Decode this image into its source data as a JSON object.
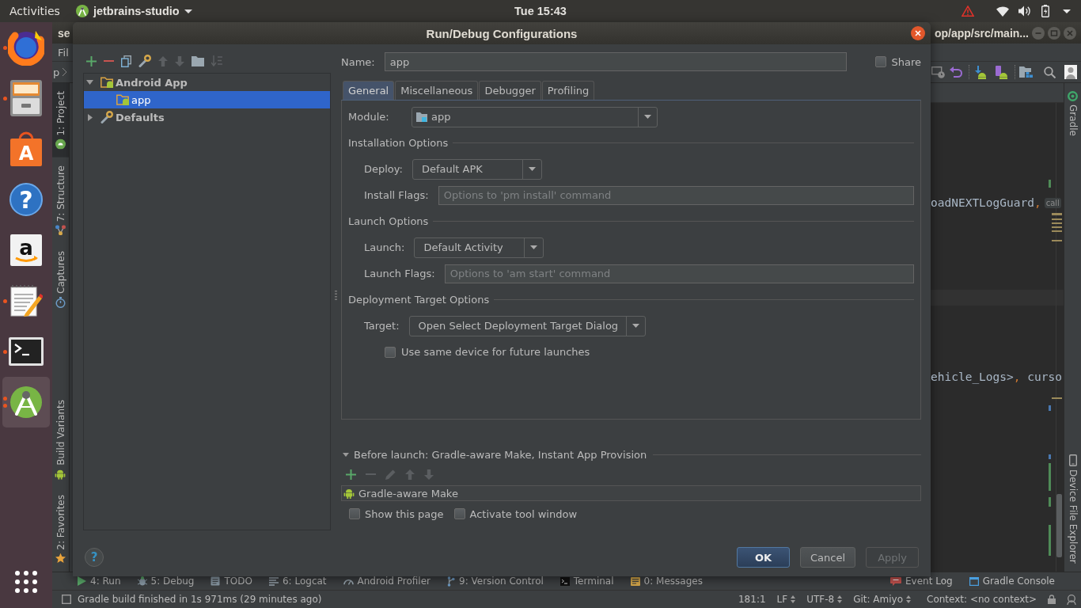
{
  "top_bar": {
    "activities": "Activities",
    "app_menu": "jetbrains-studio",
    "clock": "Tue 15:43"
  },
  "dock": {
    "items": [
      {
        "kind": "firefox",
        "running": true,
        "multi_window": false,
        "selected": false
      },
      {
        "kind": "files",
        "running": true,
        "multi_window": false,
        "selected": false
      },
      {
        "kind": "software",
        "glyph": "A",
        "running": false,
        "multi_window": false,
        "selected": false
      },
      {
        "kind": "help",
        "glyph": "?",
        "running": false,
        "multi_window": false,
        "selected": false
      },
      {
        "kind": "amazon",
        "glyph": "a",
        "running": false,
        "multi_window": false,
        "selected": false
      },
      {
        "kind": "text-editor",
        "running": true,
        "multi_window": false,
        "selected": false
      },
      {
        "kind": "terminal",
        "running": true,
        "multi_window": false,
        "selected": false
      },
      {
        "kind": "android-studio",
        "running": true,
        "multi_window": true,
        "selected": true
      }
    ]
  },
  "ide": {
    "title_left": "se",
    "title_right": "op/app/src/main...",
    "menu_first": "Fil",
    "breadcrumb": "p",
    "left_tools_top": [
      {
        "label": "1: Project",
        "kind": "android",
        "selected": true
      },
      {
        "label": "7: Structure",
        "kind": "structure",
        "selected": false
      },
      {
        "label": "Captures",
        "kind": "captures",
        "selected": false
      }
    ],
    "left_tools_bottom": [
      {
        "label": "Build Variants",
        "kind": "android-robot",
        "selected": false
      },
      {
        "label": "2: Favorites",
        "kind": "star",
        "selected": false
      }
    ],
    "right_tools_top": [
      {
        "label": "Gradle",
        "kind": "gradle"
      }
    ],
    "right_tools_bottom": [
      {
        "label": "Device File Explorer",
        "kind": "phone"
      }
    ],
    "editor_lines": [
      {
        "tokens": [
          {
            "kind": "ident",
            "text": "oadNEXTLogGuard"
          },
          {
            "kind": "punct",
            "text": ","
          },
          {
            "kind": "hint",
            "text": "call"
          }
        ]
      },
      {
        "tokens": [
          {
            "kind": "ident",
            "text": "ehicle_Logs>"
          },
          {
            "kind": "punct",
            "text": ", "
          },
          {
            "kind": "ident",
            "text": "curso"
          }
        ]
      }
    ],
    "bottom_tools_left": [
      {
        "label": "4: Run",
        "kind": "run"
      },
      {
        "label": "5: Debug",
        "kind": "debug"
      },
      {
        "label": "TODO",
        "kind": "todo"
      },
      {
        "label": "6: Logcat",
        "kind": "logcat"
      },
      {
        "label": "Android Profiler",
        "kind": "profiler"
      },
      {
        "label": "9: Version Control",
        "kind": "vcs"
      },
      {
        "label": "Terminal",
        "kind": "terminal"
      },
      {
        "label": "0: Messages",
        "kind": "messages"
      }
    ],
    "bottom_tools_right": [
      {
        "label": "Event Log",
        "kind": "event-log"
      },
      {
        "label": "Gradle Console",
        "kind": "console"
      }
    ],
    "status": {
      "message": "Gradle build finished in 1s 971ms (29 minutes ago)",
      "position": "181:1",
      "line_separator": "LF",
      "encoding": "UTF-8",
      "branch": "Git: Amiyo",
      "context": "Context: <no context>"
    }
  },
  "dialog": {
    "title": "Run/Debug Configurations",
    "tree_toolbar": [
      {
        "kind": "add",
        "disabled": false
      },
      {
        "kind": "remove",
        "disabled": false
      },
      {
        "kind": "copy",
        "disabled": false
      },
      {
        "kind": "defaults",
        "disabled": false
      },
      {
        "kind": "up",
        "disabled": true
      },
      {
        "kind": "down",
        "disabled": true
      },
      {
        "kind": "folder",
        "disabled": false
      },
      {
        "kind": "sort",
        "disabled": true
      }
    ],
    "tree": [
      {
        "label": "Android App",
        "kind": "android-folder",
        "expanded": true,
        "selected": false,
        "children": [
          {
            "label": "app",
            "kind": "android-folder",
            "selected": true
          }
        ]
      },
      {
        "label": "Defaults",
        "kind": "wrench",
        "expanded": false,
        "selected": false
      }
    ],
    "name": {
      "label": "Name:",
      "value": "app"
    },
    "share": {
      "label": "Share",
      "checked": false
    },
    "tabs": [
      {
        "label": "General",
        "selected": true
      },
      {
        "label": "Miscellaneous",
        "selected": false
      },
      {
        "label": "Debugger",
        "selected": false
      },
      {
        "label": "Profiling",
        "selected": false
      }
    ],
    "module": {
      "label": "Module:",
      "value": "app"
    },
    "sections": [
      {
        "title": "Installation Options",
        "rows": [
          {
            "kind": "combo",
            "label": "Deploy:",
            "value": "Default APK"
          },
          {
            "kind": "text",
            "label": "Install Flags:",
            "placeholder": "Options to 'pm install' command"
          }
        ]
      },
      {
        "title": "Launch Options",
        "rows": [
          {
            "kind": "combo",
            "label": "Launch:",
            "value": "Default Activity"
          },
          {
            "kind": "text",
            "label": "Launch Flags:",
            "placeholder": "Options to 'am start' command"
          }
        ]
      },
      {
        "title": "Deployment Target Options",
        "rows": [
          {
            "kind": "combo",
            "label": "Target:",
            "value": "Open Select Deployment Target Dialog"
          },
          {
            "kind": "checkbox",
            "label": "Use same device for future launches",
            "checked": false
          }
        ]
      }
    ],
    "before_launch": {
      "title": "Before launch: Gradle-aware Make, Instant App Provision",
      "expanded": true,
      "toolbar": [
        {
          "kind": "add",
          "disabled": false
        },
        {
          "kind": "remove",
          "disabled": true
        },
        {
          "kind": "edit",
          "disabled": true
        },
        {
          "kind": "up",
          "disabled": true
        },
        {
          "kind": "down",
          "disabled": true
        }
      ],
      "tasks": [
        {
          "label": "Gradle-aware Make",
          "selected": false
        }
      ],
      "options": [
        {
          "label": "Show this page",
          "checked": false
        },
        {
          "label": "Activate tool window",
          "checked": false
        }
      ]
    },
    "help_button": "?",
    "buttons": [
      {
        "label": "OK",
        "kind": "default",
        "disabled": false
      },
      {
        "label": "Cancel",
        "kind": "normal",
        "disabled": false
      },
      {
        "label": "Apply",
        "kind": "normal",
        "disabled": true
      }
    ]
  }
}
